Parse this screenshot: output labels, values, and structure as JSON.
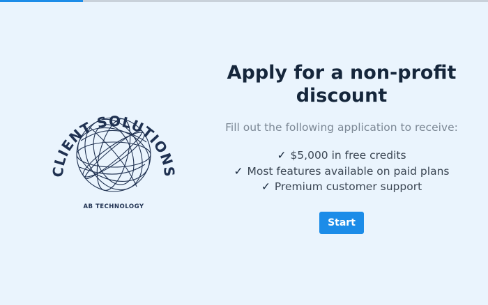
{
  "progress": {
    "fraction": 0.17
  },
  "logo": {
    "arc_text": "CLIENT SOLUTIONS",
    "tagline": "AB TECHNOLOGY",
    "color": "#1f3151"
  },
  "main": {
    "title": "Apply for a non-profit discount",
    "subtitle": "Fill out the following application to receive:",
    "check_glyph": "✓",
    "benefits": [
      {
        "label": "$5,000 in free credits"
      },
      {
        "label": "Most features available on paid plans"
      },
      {
        "label": "Premium customer support"
      }
    ],
    "start_label": "Start"
  },
  "colors": {
    "background": "#eaf4fd",
    "accent": "#1c8ce8",
    "title": "#15263b",
    "muted": "#7b8794"
  }
}
